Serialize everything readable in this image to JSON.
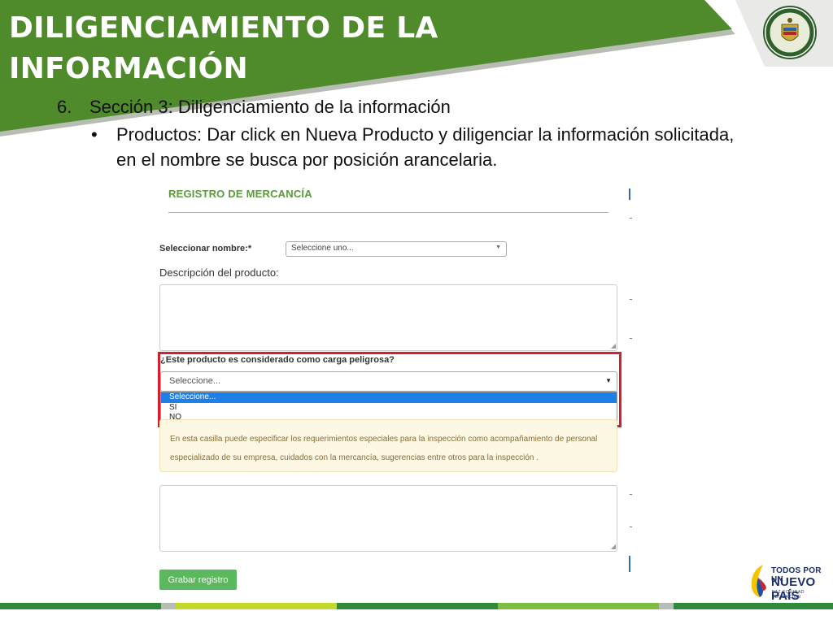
{
  "slide": {
    "title": "DILIGENCIAMIENTO DE LA INFORMACIÓN",
    "step_number": "6.",
    "step_text": "Sección 3: Diligenciamiento de la información",
    "bullet_symbol": "•",
    "bullet_text": "Productos: Dar click en Nueva Producto y diligenciar la información solicitada, en el nombre se busca por posición arancelaria."
  },
  "form": {
    "heading": "REGISTRO DE MERCANCÍA",
    "name_label": "Seleccionar nombre:*",
    "name_select_value": "Seleccione uno...",
    "description_label": "Descripción del producto:",
    "dangerous_label": "¿Este producto es considerado como carga peligrosa?",
    "dangerous_select_value": "Seleccione...",
    "dangerous_options": [
      "Seleccione...",
      "SI",
      "NO"
    ],
    "info_text": "En esta casilla puede especificar los requerimientos especiales para la inspección como acompañamiento de personal especializado de su empresa, cuidados con la mercancía, sugerencias entre otros para la inspección .",
    "save_button": "Grabar registro"
  },
  "branding": {
    "line1": "TODOS POR UN",
    "line2": "NUEVO PAÍS",
    "line3": "PAZ   EQUIDAD   EDUCACIÓN"
  },
  "colors": {
    "header_green": "#4f8a2b",
    "highlight_red": "#d4202c",
    "selected_option": "#1e7fe6",
    "button_green": "#5cb85c"
  }
}
